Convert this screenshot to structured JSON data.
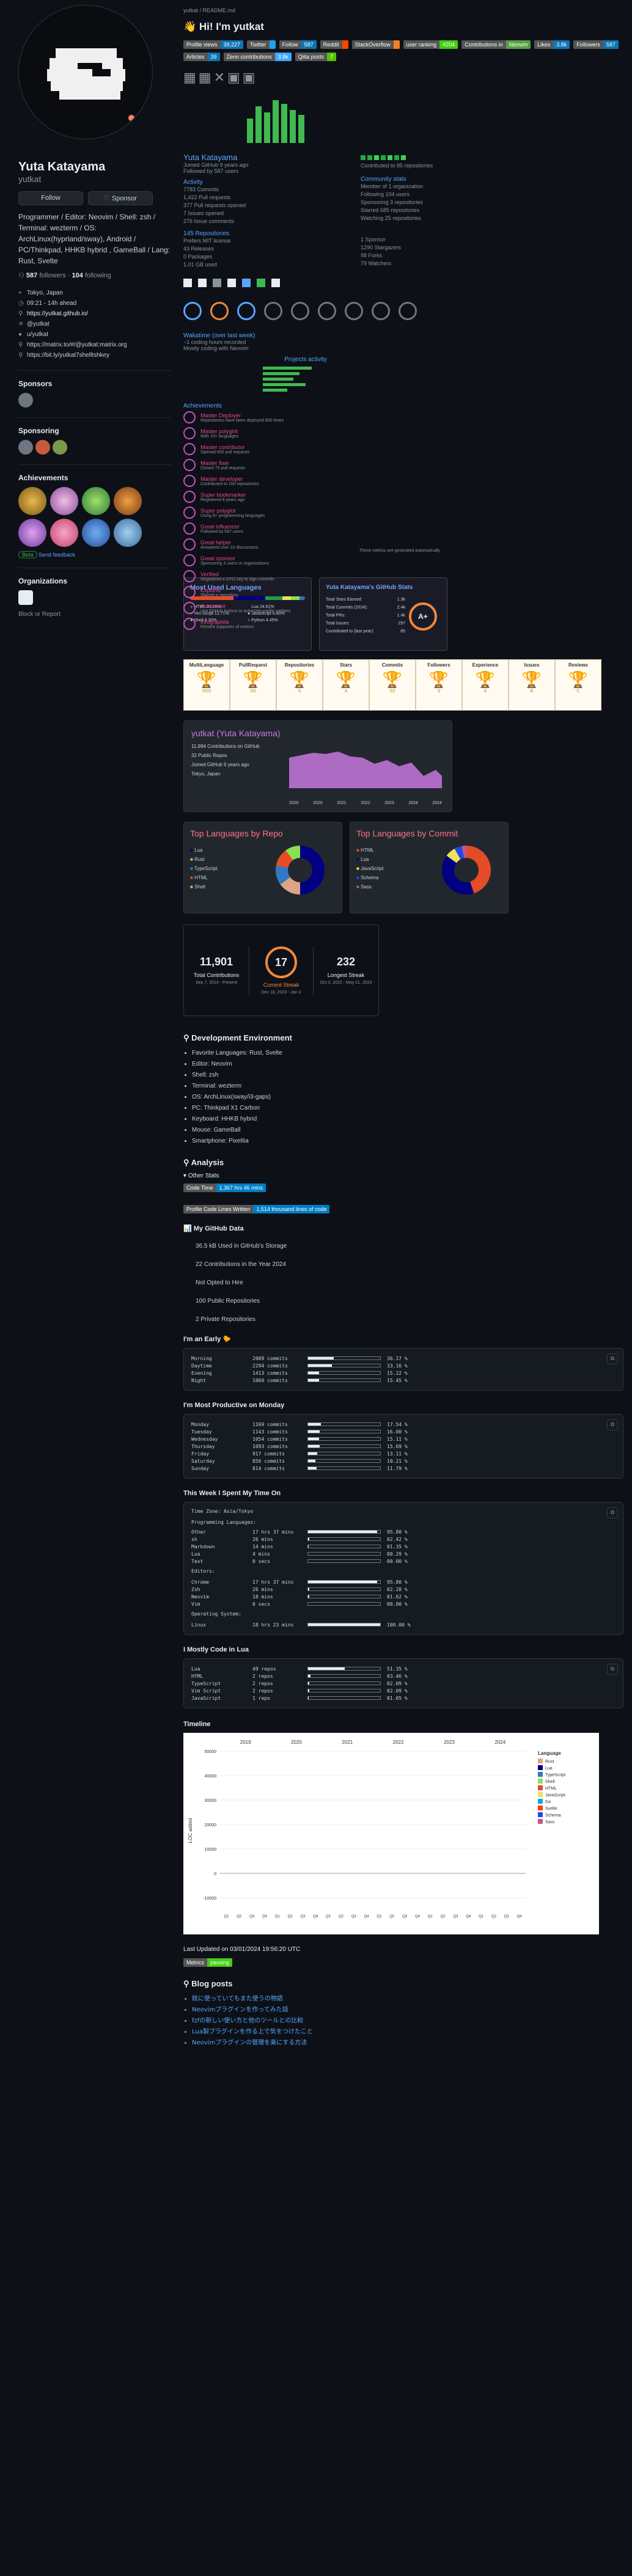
{
  "profile": {
    "name": "Yuta Katayama",
    "login": "yutkat",
    "follow_label": "Follow",
    "sponsor_label": "Sponsor",
    "bio": "Programmer / Editor: Neovim / Shell: zsh / Terminal: wezterm / OS: ArchLinux(hyprland/sway), Android / PC/Thinkpad, HHKB hybrid , GameBall / Lang: Rust, Svelte",
    "followers": "587",
    "followers_label": "followers",
    "following": "104",
    "following_label": "following",
    "info": [
      "Tokyo, Japan",
      "09:21 - 14h ahead",
      "https://yutkat.github.io/",
      "@yutkat",
      "u/yutkat",
      "https://matrix.to/#/@yutkat:matrix.org",
      "https://bit.ly/yutkat7shelltshkey"
    ],
    "sponsors_title": "Sponsors",
    "sponsoring_title": "Sponsoring",
    "achievements_title": "Achievements",
    "beta_label": "Beta",
    "feedback_label": "Send feedback",
    "organizations_title": "Organizations",
    "block_label": "Block or Report"
  },
  "readme": {
    "breadcrumb": "yutkat / README.md",
    "greeting": "👋 Hi! I'm yutkat",
    "badges": [
      {
        "l": "Profile views",
        "r": "39,227",
        "c": "#0e75b6"
      },
      {
        "l": "Twitter",
        "r": "",
        "c": "#1da1f2"
      },
      {
        "l": "Follow",
        "r": "587",
        "c": "#0e75b6"
      },
      {
        "l": "Reddit",
        "r": "",
        "c": "#ff4500"
      },
      {
        "l": "StackOverflow",
        "r": "",
        "c": "#f48024"
      },
      {
        "l": "user ranking",
        "r": "#204",
        "c": "#4c1"
      },
      {
        "l": "Contributions in",
        "r": "Neovim",
        "c": "#57a143"
      },
      {
        "l": "Likes",
        "r": "3.8k",
        "c": "#0e75b6"
      },
      {
        "l": "Followers",
        "r": "587",
        "c": "#0e75b6"
      },
      {
        "l": "Articles",
        "r": "39",
        "c": "#0e75b6"
      },
      {
        "l": "Zenn contributions",
        "r": "3.8k",
        "c": "#3ea8ff"
      },
      {
        "l": "Qiita posts",
        "r": "7",
        "c": "#55c500"
      }
    ],
    "card_user": {
      "name": "Yuta Katayama",
      "joined": "Joined GitHub 9 years ago",
      "followers": "Followed by 587 users"
    },
    "activity_title": "Activity",
    "activity": [
      "7783 Commits",
      "1,422 Pull requests",
      "377 Pull requests opened",
      "7 Issues opened",
      "276 Issue comments"
    ],
    "community_title": "Community stats",
    "community": [
      "Member of 1 organization",
      "Following 104 users",
      "Sponsoring 3 repositories",
      "Starred 685 repositories",
      "Watching 25 repositories"
    ],
    "repos_title": "145 Repositories",
    "repos": [
      "Prefers MIT license",
      "43 Releases",
      "0 Packages",
      "1.01 GB used"
    ],
    "repos2": [
      "1 Sponsor",
      "1290 Stargazers",
      "98 Forks",
      "79 Watchers"
    ],
    "contrib": "Contributed to 85 repositories",
    "langs_title": "Isocalendar",
    "wakatime": "Wakatime (over last week)",
    "wt1": "~1 coding hours recorded",
    "wt2": "Mostly coding with Neovim",
    "projects_title": "Projects activity",
    "achievements_title": "Achievements",
    "ach_list": [
      {
        "t": "Master Deployer",
        "s": "Repositories have been deployed 800 times"
      },
      {
        "t": "Master polyglot",
        "s": "With 10+ languages"
      },
      {
        "t": "Master contributor",
        "s": "Opened 800 pull requests"
      },
      {
        "t": "Master fixer",
        "s": "Closed 75 pull requests"
      },
      {
        "t": "Master developer",
        "s": "Contributed to 100 repositories"
      },
      {
        "t": "Super bookmarker",
        "s": "Registered 8 years ago"
      },
      {
        "t": "Super polyglot",
        "s": "Using 9+ programming languages"
      },
      {
        "t": "Great influencer",
        "s": "Followed by 587 users"
      },
      {
        "t": "Great helper",
        "s": "Answered over 10 discussions"
      },
      {
        "t": "Great sponsor",
        "s": "Sponsoring 3 users or organizations"
      },
      {
        "t": "Verified",
        "s": "Registered a GPG key to sign commits"
      },
      {
        "t": "Explorer",
        "s": "Starred a repository"
      },
      {
        "t": "Automator",
        "s": "Use GitHub Actions to automate profile updates"
      },
      {
        "t": "Infographile",
        "s": "Fervent supporter of metrics"
      }
    ],
    "footer_note": "These metrics are generated automatically",
    "most_used_title": "Most Used Languages",
    "most_used": [
      {
        "n": "HTML",
        "p": "33.28%",
        "c": "#e34c26"
      },
      {
        "n": "Lua",
        "p": "24.61%",
        "c": "#000080"
      },
      {
        "n": "Vim Script",
        "p": "12.71%",
        "c": "#199f4b"
      },
      {
        "n": "JavaScript",
        "p": "6.83%",
        "c": "#f1e05a"
      },
      {
        "n": "Shell",
        "p": "6.30%",
        "c": "#89e051"
      },
      {
        "n": "Python",
        "p": "4.45%",
        "c": "#3572a5"
      }
    ],
    "stats_title": "Yuta Katayama's GitHub Stats",
    "stats": [
      {
        "k": "Total Stars Earned:",
        "v": "1.3k"
      },
      {
        "k": "Total Commits (2024):",
        "v": "2.4k"
      },
      {
        "k": "Total PRs:",
        "v": "1.4k"
      },
      {
        "k": "Total Issues:",
        "v": "297"
      },
      {
        "k": "Contributed to (last year):",
        "v": "85"
      }
    ],
    "grade": "A+",
    "trophies": [
      "MultiLanguage",
      "PullRequest",
      "Repositories",
      "Stars",
      "Commits",
      "Followers",
      "Experience",
      "Issues",
      "Reviews"
    ],
    "trophy_ranks": [
      "SSS",
      "SS",
      "S",
      "A",
      "SS",
      "S",
      "A",
      "B",
      "C"
    ],
    "graph_title": "yutkat (Yuta Katayama)",
    "graph_items": [
      "11,994 Contributions on GitHub",
      "32 Public Repos",
      "Joined GitHub 9 years ago",
      "Tokyo, Japan"
    ],
    "graph_x": [
      "2020",
      "2020",
      "2021",
      "2022",
      "2023",
      "2024",
      "2024"
    ],
    "repo_langs_title": "Top Languages by Repo",
    "repo_langs": [
      {
        "n": "Lua",
        "c": "#000080"
      },
      {
        "n": "Rust",
        "c": "#dea584"
      },
      {
        "n": "TypeScript",
        "c": "#3178c6"
      },
      {
        "n": "HTML",
        "c": "#e34c26"
      },
      {
        "n": "Shell",
        "c": "#89e051"
      }
    ],
    "commit_langs_title": "Top Languages by Commit",
    "commit_langs": [
      {
        "n": "HTML",
        "c": "#e34c26"
      },
      {
        "n": "Lua",
        "c": "#000080"
      },
      {
        "n": "JavaScript",
        "c": "#f1e05a"
      },
      {
        "n": "Schema",
        "c": "#1e4aec"
      },
      {
        "n": "Sass",
        "c": "#c6538c"
      }
    ],
    "streak": {
      "total": "11,901",
      "total_label": "Total Contributions",
      "total_range": "Sep 7, 2014 - Present",
      "current": "17",
      "current_label": "Current Streak",
      "current_range": "Dec 18, 2023 - Jan 3",
      "longest": "232",
      "longest_label": "Longest Streak",
      "longest_range": "Oct 3, 2022 - May 21, 2023"
    },
    "dev_env_title": "Development Environment",
    "dev_env": [
      "Favorite Languages: Rust, Svelte",
      "Editor: Neovim",
      "Shell: zsh",
      "Terminal: wezterm",
      "OS: ArchLinux(sway/i3-gaps)",
      "PC: Thinkpad X1 Carbon",
      "Keyboard: HHKB hybrid",
      "Mouse: GameBall",
      "Smartphone: Pixel6a"
    ],
    "analysis_title": "Analysis",
    "other_stats": "Other Stats",
    "code_time": {
      "l": "Code Time",
      "r": "1,367 hrs 46 mins"
    },
    "lines_written": {
      "l": "Profile Code Lines Written",
      "r": "1,514 thousand lines of code"
    },
    "gh_data_title": "My GitHub Data",
    "gh_data": [
      "36.5 kB Used in GitHub's Storage",
      "22 Contributions in the Year 2024",
      "Not Opted to Hire",
      "100 Public Repositories",
      "2 Private Repositories"
    ],
    "early_title": "I'm an Early 🐤",
    "early": [
      {
        "n": "Morning",
        "c": "2009 commits",
        "p": "36.17 %",
        "f": 0.36
      },
      {
        "n": "Daytime",
        "c": "2294 commits",
        "p": "33.16 %",
        "f": 0.33
      },
      {
        "n": "Evening",
        "c": "1413 commits",
        "p": "15.22 %",
        "f": 0.15
      },
      {
        "n": "Night",
        "c": "1060 commits",
        "p": "15.45 %",
        "f": 0.15
      }
    ],
    "weekday_title": "I'm Most Productive on Monday",
    "weekday": [
      {
        "n": "Monday",
        "c": "1169 commits",
        "p": "17.54 %",
        "f": 0.18
      },
      {
        "n": "Tuesday",
        "c": "1143 commits",
        "p": "16.00 %",
        "f": 0.16
      },
      {
        "n": "Wednesday",
        "c": "1054 commits",
        "p": "15.11 %",
        "f": 0.15
      },
      {
        "n": "Thursday",
        "c": "1093 commits",
        "p": "15.69 %",
        "f": 0.16
      },
      {
        "n": "Friday",
        "c": "917 commits",
        "p": "13.11 %",
        "f": 0.13
      },
      {
        "n": "Saturday",
        "c": "856 commits",
        "p": "10.21 %",
        "f": 0.1
      },
      {
        "n": "Sunday",
        "c": "814 commits",
        "p": "11.79 %",
        "f": 0.12
      }
    ],
    "week_title": "This Week I Spent My Time On",
    "tz": "Time Zone: Asia/Tokyo",
    "prog_langs": "Programming Languages:",
    "week_langs": [
      {
        "n": "Other",
        "c": "17 hrs 37 mins",
        "p": "95.80 %",
        "f": 0.96
      },
      {
        "n": "sh",
        "c": "26 mins",
        "p": "02.42 %",
        "f": 0.02
      },
      {
        "n": "Markdown",
        "c": "14 mins",
        "p": "01.35 %",
        "f": 0.01
      },
      {
        "n": "Lua",
        "c": "4 mins",
        "p": "00.29 %",
        "f": 0.0
      },
      {
        "n": "Text",
        "c": "0 secs",
        "p": "00.00 %",
        "f": 0.0
      }
    ],
    "editors": "Editors:",
    "week_editors": [
      {
        "n": "Chrome",
        "c": "17 hrs 37 mins",
        "p": "95.80 %",
        "f": 0.96
      },
      {
        "n": "Zsh",
        "c": "26 mins",
        "p": "02.28 %",
        "f": 0.02
      },
      {
        "n": "Neovim",
        "c": "18 mins",
        "p": "01.62 %",
        "f": 0.02
      },
      {
        "n": "Vim",
        "c": "0 secs",
        "p": "00.00 %",
        "f": 0.0
      }
    ],
    "os_label": "Operating System:",
    "week_os": [
      {
        "n": "Linux",
        "c": "18 hrs 23 mins",
        "p": "100.00 %",
        "f": 1.0
      }
    ],
    "lua_title": "I Mostly Code in Lua",
    "lua": [
      {
        "n": "Lua",
        "c": "49 repos",
        "p": "51.35 %",
        "f": 0.51
      },
      {
        "n": "HTML",
        "c": "2 repos",
        "p": "03.46 %",
        "f": 0.03
      },
      {
        "n": "TypeScript",
        "c": "2 repos",
        "p": "02.09 %",
        "f": 0.02
      },
      {
        "n": "Vim Script",
        "c": "2 repos",
        "p": "02.09 %",
        "f": 0.02
      },
      {
        "n": "JavaScript",
        "c": "1 repo",
        "p": "01.05 %",
        "f": 0.01
      }
    ],
    "timeline_title": "Timeline",
    "updated": "Last Updated on 03/01/2024 19:56:20 UTC",
    "metrics_badge": {
      "l": "Metrics",
      "r": "passing"
    },
    "blog_title": "Blog posts",
    "blog": [
      "既に使っていてもまた使うの物語",
      "Neovimプラグインを作ってみた話",
      "fzfの新しい使い方と他のツールとの比較",
      "Lua製プラグインを作る上で気をつけたこと",
      "Neovimプラグインの管理を楽にする方法"
    ]
  },
  "chart_data": {
    "type": "bar",
    "title": "",
    "ylabel": "LOC added",
    "x_years": [
      "2019",
      "2020",
      "2021",
      "2022",
      "2023",
      "2024"
    ],
    "quarters": [
      "Q1",
      "Q2",
      "Q3",
      "Q4"
    ],
    "ylim": [
      -15000,
      50000
    ],
    "y_ticks": [
      -10000,
      0,
      10000,
      20000,
      30000,
      40000,
      50000
    ],
    "legend_title": "Language",
    "series": [
      {
        "name": "Rust",
        "color": "#dea584"
      },
      {
        "name": "Lua",
        "color": "#000080"
      },
      {
        "name": "TypeScript",
        "color": "#3178c6"
      },
      {
        "name": "Shell",
        "color": "#89e051"
      },
      {
        "name": "HTML",
        "color": "#e34c26"
      },
      {
        "name": "JavaScript",
        "color": "#f1e05a"
      },
      {
        "name": "Go",
        "color": "#00add8"
      },
      {
        "name": "Svelte",
        "color": "#ff3e00"
      },
      {
        "name": "Schema",
        "color": "#1e4aec"
      },
      {
        "name": "Sass",
        "color": "#c6538c"
      }
    ]
  }
}
